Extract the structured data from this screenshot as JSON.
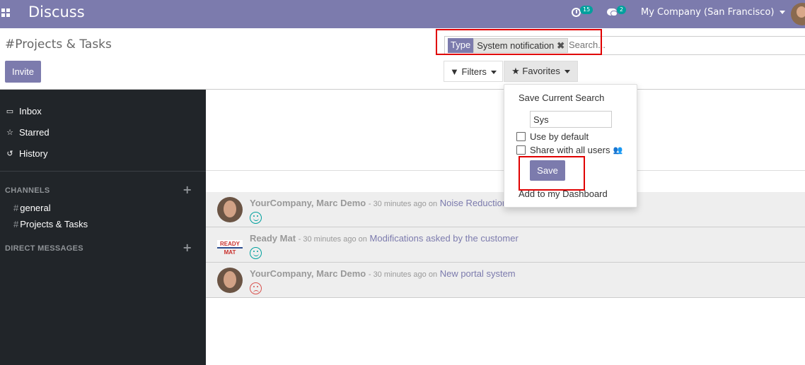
{
  "navbar": {
    "app_title": "Discuss",
    "activity_count": "15",
    "messages_count": "2",
    "company": "My Company (San Francisco)"
  },
  "control_panel": {
    "breadcrumb": "#Projects & Tasks",
    "invite_label": "Invite",
    "search": {
      "facet_type": "Type",
      "facet_value": "System notification",
      "placeholder": "Search..."
    },
    "filters_label": "Filters",
    "favorites_label": "Favorites"
  },
  "sidebar": {
    "items": [
      {
        "label": "Inbox",
        "icon": "inbox-icon"
      },
      {
        "label": "Starred",
        "icon": "star-icon"
      },
      {
        "label": "History",
        "icon": "history-icon"
      }
    ],
    "channels_header": "CHANNELS",
    "channels": [
      {
        "label": "general"
      },
      {
        "label": "Projects & Tasks"
      }
    ],
    "dm_header": "DIRECT MESSAGES"
  },
  "messages": [
    {
      "author": "YourCompany, Marc Demo",
      "time": "- 30 minutes ago on",
      "subject": "Noise Reduction",
      "mood": "happy"
    },
    {
      "author": "Ready Mat",
      "time": "- 30 minutes ago on",
      "subject": "Modifications asked by the customer",
      "mood": "happy",
      "logo_text": "READY MAT"
    },
    {
      "author": "YourCompany, Marc Demo",
      "time": "- 30 minutes ago on",
      "subject": "New portal system",
      "mood": "sad"
    }
  ],
  "favorites_dropdown": {
    "title": "Save Current Search",
    "name_value": "Sys",
    "use_by_default": "Use by default",
    "share_all": "Share with all users",
    "save_label": "Save",
    "dashboard_label": "Add to my Dashboard"
  },
  "colors": {
    "brand": "#7c7bad",
    "sidebar": "#212529",
    "highlight": "#e00000",
    "teal": "#00a09d"
  }
}
